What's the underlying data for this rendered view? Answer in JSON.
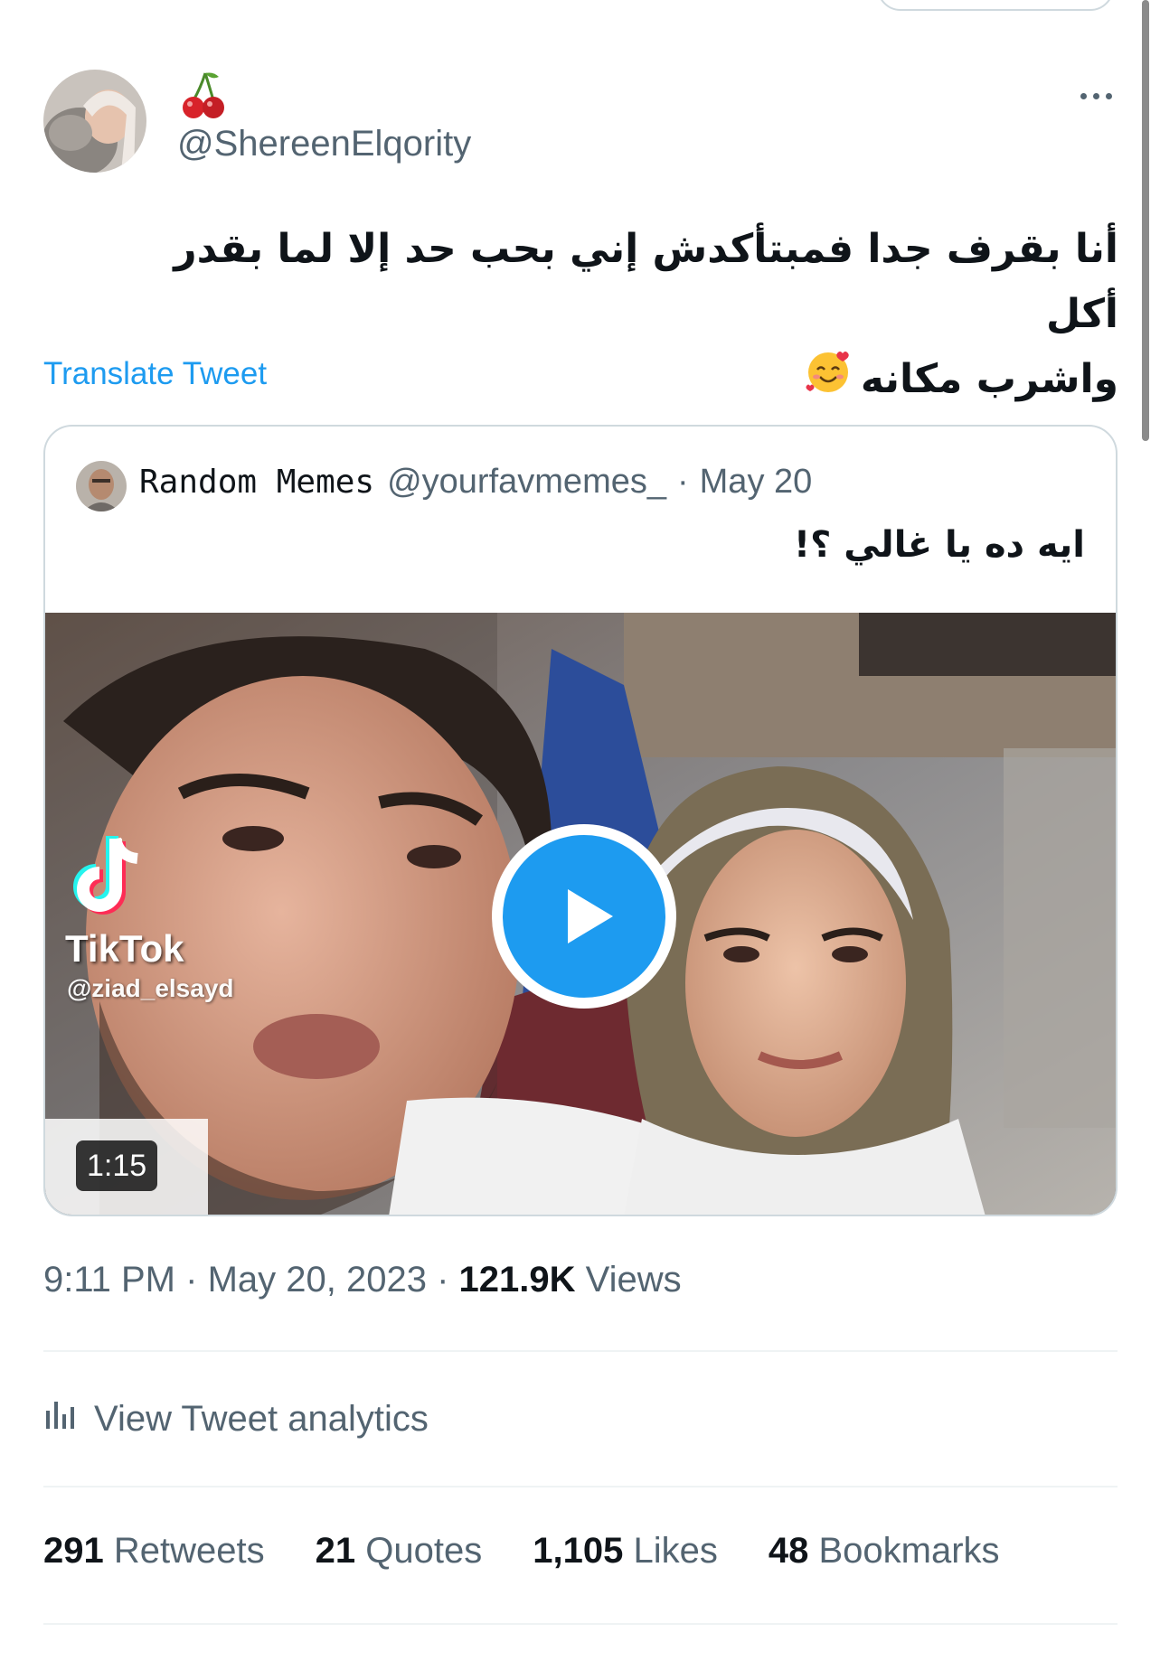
{
  "author": {
    "display_emoji": "cherries",
    "handle": "@ShereenElqority"
  },
  "tweet": {
    "text_line1": "أنا بقرف جدا فمبتأكدش إني بحب حد إلا لما بقدر أكل",
    "text_line2": "واشرب مكانه",
    "emoji": "smiling-face-with-hearts",
    "translate_label": "Translate Tweet"
  },
  "quoted_tweet": {
    "name": "Random Memes",
    "handle": "@yourfavmemes_",
    "separator": "·",
    "date": "May 20",
    "text": "ايه ده يا غالي ؟!",
    "video": {
      "duration": "1:15",
      "watermark_brand": "TikTok",
      "watermark_user": "@ziad_elsayd"
    }
  },
  "meta": {
    "time": "9:11 PM",
    "separator": "·",
    "date": "May 20, 2023",
    "views_count": "121.9K",
    "views_label": "Views"
  },
  "analytics": {
    "label": "View Tweet analytics"
  },
  "stats": {
    "retweets": {
      "count": "291",
      "label": "Retweets"
    },
    "quotes": {
      "count": "21",
      "label": "Quotes"
    },
    "likes": {
      "count": "1,105",
      "label": "Likes"
    },
    "bookmarks": {
      "count": "48",
      "label": "Bookmarks"
    }
  },
  "colors": {
    "accent": "#1d9bf0",
    "text_primary": "#0f1419",
    "text_secondary": "#536471",
    "border": "#cfd9de"
  }
}
